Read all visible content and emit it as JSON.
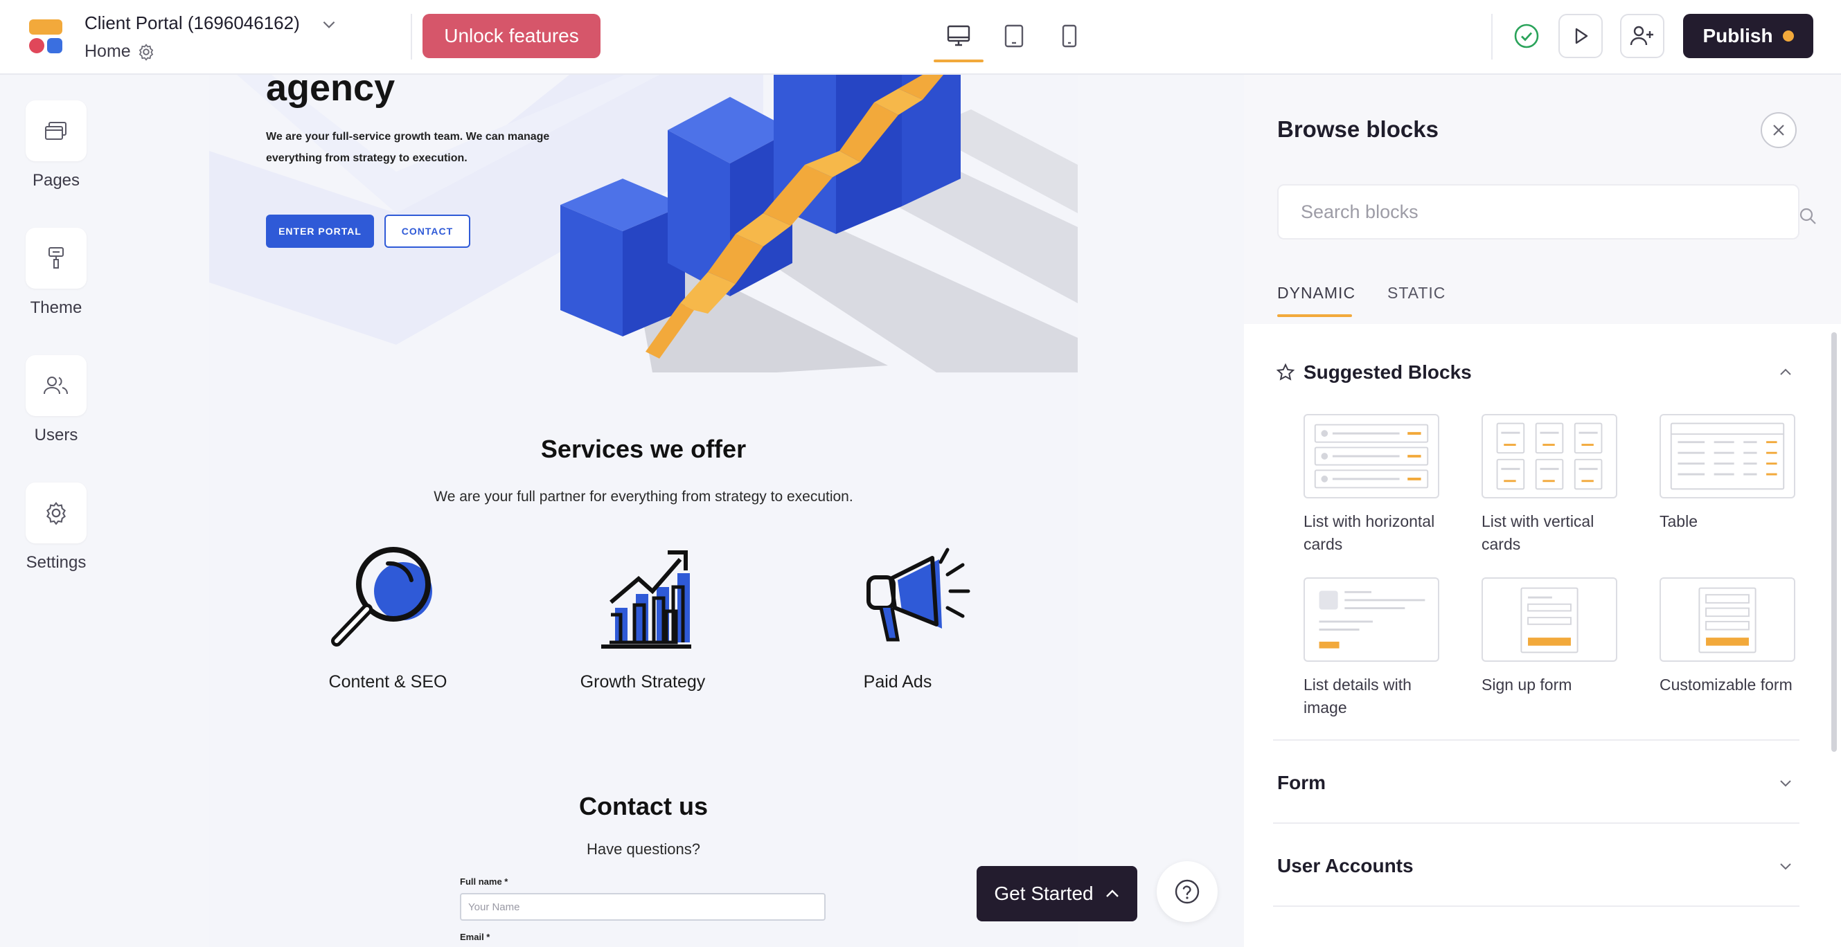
{
  "colors": {
    "brand_dark": "#231c2e",
    "accent_orange": "#f2a93b",
    "unlock_red": "#d6566a",
    "portal_blue": "#2f5ad7"
  },
  "topbar": {
    "project_title": "Client Portal (1696046162)",
    "page_name": "Home",
    "unlock_label": "Unlock features",
    "publish_label": "Publish",
    "device_icons": [
      "desktop-icon",
      "tablet-icon",
      "mobile-icon"
    ],
    "active_device": "desktop"
  },
  "sidebar": {
    "items": [
      {
        "label": "Pages",
        "icon": "pages-icon"
      },
      {
        "label": "Theme",
        "icon": "paint-roller-icon"
      },
      {
        "label": "Users",
        "icon": "users-icon"
      },
      {
        "label": "Settings",
        "icon": "gear-icon"
      }
    ]
  },
  "canvas": {
    "hero": {
      "heading": "agency",
      "paragraph": "We are your full-service growth team. We can manage everything from strategy to execution.",
      "primary_button": "ENTER PORTAL",
      "secondary_button": "CONTACT"
    },
    "services": {
      "title": "Services we offer",
      "subtitle": "We are your full partner for everything from strategy to execution.",
      "items": [
        {
          "label": "Content & SEO",
          "icon": "magnifier-icon"
        },
        {
          "label": "Growth Strategy",
          "icon": "growth-chart-icon"
        },
        {
          "label": "Paid Ads",
          "icon": "megaphone-icon"
        }
      ]
    },
    "contact": {
      "title": "Contact us",
      "subtitle": "Have questions?",
      "fields": [
        {
          "label": "Full name *",
          "placeholder": "Your Name"
        },
        {
          "label": "Email *",
          "placeholder": ""
        }
      ]
    }
  },
  "floating": {
    "get_started_label": "Get Started"
  },
  "panel": {
    "title": "Browse blocks",
    "search_placeholder": "Search blocks",
    "tabs": [
      {
        "label": "DYNAMIC",
        "active": true
      },
      {
        "label": "STATIC",
        "active": false
      }
    ],
    "suggested": {
      "title": "Suggested Blocks",
      "expanded": true,
      "blocks": [
        {
          "label": "List with horizontal cards",
          "thumb": "horizontal-cards"
        },
        {
          "label": "List with vertical cards",
          "thumb": "vertical-cards"
        },
        {
          "label": "Table",
          "thumb": "table"
        },
        {
          "label": "List details with image",
          "thumb": "details-image"
        },
        {
          "label": "Sign up form",
          "thumb": "signup-form"
        },
        {
          "label": "Customizable form",
          "thumb": "custom-form"
        }
      ]
    },
    "sections": [
      {
        "title": "Form",
        "expanded": false
      },
      {
        "title": "User Accounts",
        "expanded": false
      }
    ]
  }
}
